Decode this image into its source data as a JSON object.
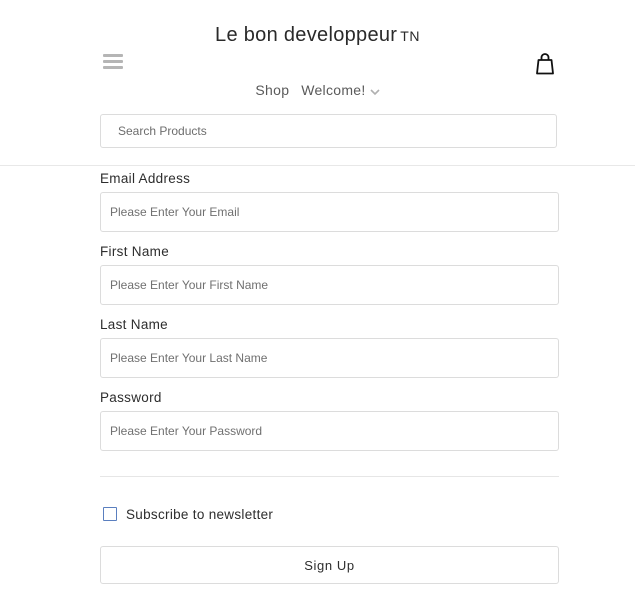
{
  "header": {
    "brand_name": "Le bon developpeur",
    "brand_suffix": "TN",
    "nav": {
      "shop_label": "Shop",
      "welcome_label": "Welcome!"
    },
    "search": {
      "placeholder": "Search Products"
    }
  },
  "form": {
    "fields": [
      {
        "label": "Email Address",
        "placeholder": "Please Enter Your Email"
      },
      {
        "label": "First Name",
        "placeholder": "Please Enter Your First Name"
      },
      {
        "label": "Last Name",
        "placeholder": "Please Enter Your Last Name"
      },
      {
        "label": "Password",
        "placeholder": "Please Enter Your Password"
      }
    ],
    "newsletter_label": "Subscribe to newsletter",
    "newsletter_checked": false,
    "submit_label": "Sign Up"
  },
  "colors": {
    "checkbox_border": "#5a7fbf",
    "border": "#dcdcdc",
    "text": "#2d2d2d"
  },
  "icons": {
    "menu": "hamburger-menu-icon",
    "cart": "shopping-bag-icon",
    "dropdown": "chevron-down-icon"
  }
}
